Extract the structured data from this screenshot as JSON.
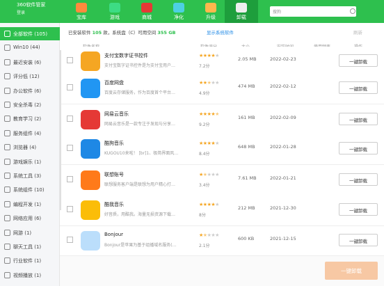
{
  "app": {
    "title": "360软件管家",
    "login": "登录"
  },
  "nav": [
    {
      "label": "宝库",
      "color": "#ff8a3d"
    },
    {
      "label": "游戏",
      "color": "#3ddc84"
    },
    {
      "label": "商城",
      "color": "#e53935"
    },
    {
      "label": "净化",
      "color": "#4dd0e1"
    },
    {
      "label": "升级",
      "color": "#ffb74d"
    },
    {
      "label": "卸载",
      "color": "#eeeeee"
    }
  ],
  "search": {
    "placeholder": "搜狗"
  },
  "sidebar": [
    {
      "label": "全部软件 (105)"
    },
    {
      "label": "Win10 (44)"
    },
    {
      "label": "最近安装 (6)"
    },
    {
      "label": "评分低 (12)"
    },
    {
      "label": "办公软件 (6)"
    },
    {
      "label": "安全杀毒 (2)"
    },
    {
      "label": "教育学习 (2)"
    },
    {
      "label": "服务组件 (4)"
    },
    {
      "label": "浏览器 (4)"
    },
    {
      "label": "游戏娱乐 (1)"
    },
    {
      "label": "系统工具 (3)"
    },
    {
      "label": "系统组件 (10)"
    },
    {
      "label": "编程开发 (1)"
    },
    {
      "label": "网络应用 (6)"
    },
    {
      "label": "网游 (1)"
    },
    {
      "label": "聊天工具 (1)"
    },
    {
      "label": "行业软件 (1)"
    },
    {
      "label": "视频播放 (1)"
    }
  ],
  "summary": {
    "prefix": "已安装软件",
    "count": "105",
    "mid": "款，系统盘（C）可用空间",
    "space": "355 GB",
    "sys_button": "显示系统软件",
    "refresh": "刷新"
  },
  "columns": {
    "name": "软件名称",
    "score": "软件评分",
    "size": "大小",
    "date": "安装时间",
    "freq": "使用频率",
    "op": "操作"
  },
  "rows": [
    {
      "name": "支付宝数字证书控件",
      "desc": "支付宝数字证书控件是为支付宝用户…",
      "stars": 4,
      "score": "7.2分",
      "size": "2.05 MB",
      "date": "2022-02-23",
      "btn": "一键卸载",
      "icon_color": "#f5a623"
    },
    {
      "name": "百度网盘",
      "desc": "百度云存储服务，作为百度首个平台…",
      "stars": 2.5,
      "score": "4.9分",
      "size": "474 MB",
      "date": "2022-02-12",
      "btn": "一键卸载",
      "icon_color": "#2196f3"
    },
    {
      "name": "网易云音乐",
      "desc": "网易云音乐是一款专注于发现与分享…",
      "stars": 4.5,
      "score": "9.2分",
      "size": "161 MB",
      "date": "2022-02-09",
      "btn": "一键卸载",
      "icon_color": "#e53935"
    },
    {
      "name": "酷狗音乐",
      "desc": "KUGOU10来啦！ [br]1、极简界面风…",
      "stars": 4,
      "score": "8.4分",
      "size": "648 MB",
      "date": "2022-01-28",
      "btn": "一键卸载",
      "icon_color": "#1e88e5"
    },
    {
      "name": "联想账号",
      "desc": "联想服务客户端是联想为用户精心打…",
      "stars": 1.5,
      "score": "3.4分",
      "size": "7.61 MB",
      "date": "2022-01-21",
      "btn": "一键卸载",
      "icon_color": "#ff7a1a"
    },
    {
      "name": "酷我音乐",
      "desc": "好音质，用酷我。海量无损资源下载…",
      "stars": 4,
      "score": "8分",
      "size": "212 MB",
      "date": "2021-12-30",
      "btn": "一键卸载",
      "icon_color": "#fbbd08"
    },
    {
      "name": "Bonjour",
      "desc": "Bonjour是苹果为基于组播域名服务(…",
      "stars": 1.5,
      "score": "2.1分",
      "size": "600 KB",
      "date": "2021-12-15",
      "btn": "一键卸载",
      "icon_color": "#bbdefb"
    }
  ],
  "bottom": {
    "uninstall_all": "一键卸载"
  }
}
